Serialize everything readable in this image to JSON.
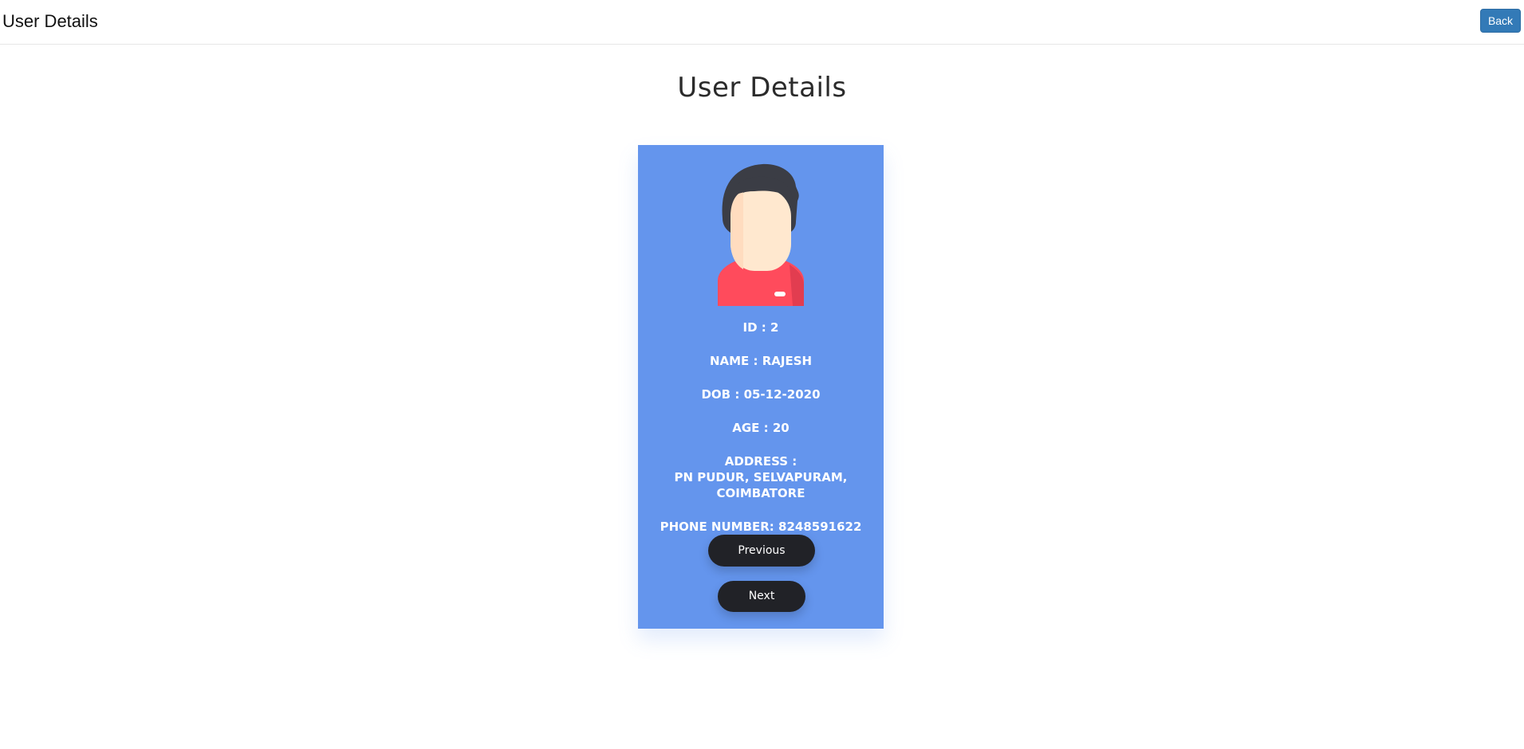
{
  "navbar": {
    "title": "User Details",
    "back_label": "Back"
  },
  "page": {
    "heading": "User Details"
  },
  "user": {
    "id_line": "ID : 2",
    "name_line": "NAME : RAJESH",
    "dob_line": "DOB : 05-12-2020",
    "age_line": "AGE : 20",
    "address_label": "ADDRESS :",
    "address_line1": "PN PUDUR, SELVAPURAM,",
    "address_line2": "COIMBATORE",
    "phone_line": "PHONE NUMBER: 8248591622",
    "avatar_icon": "user-avatar-icon"
  },
  "buttons": {
    "previous_label": "Previous",
    "next_label": "Next"
  },
  "colors": {
    "card_background": "#6495ed",
    "button_background": "#212227",
    "back_button": "#337ab7",
    "shirt": "#ff4b5c",
    "hair": "#3b3d45",
    "skin": "#ffe8cf"
  }
}
